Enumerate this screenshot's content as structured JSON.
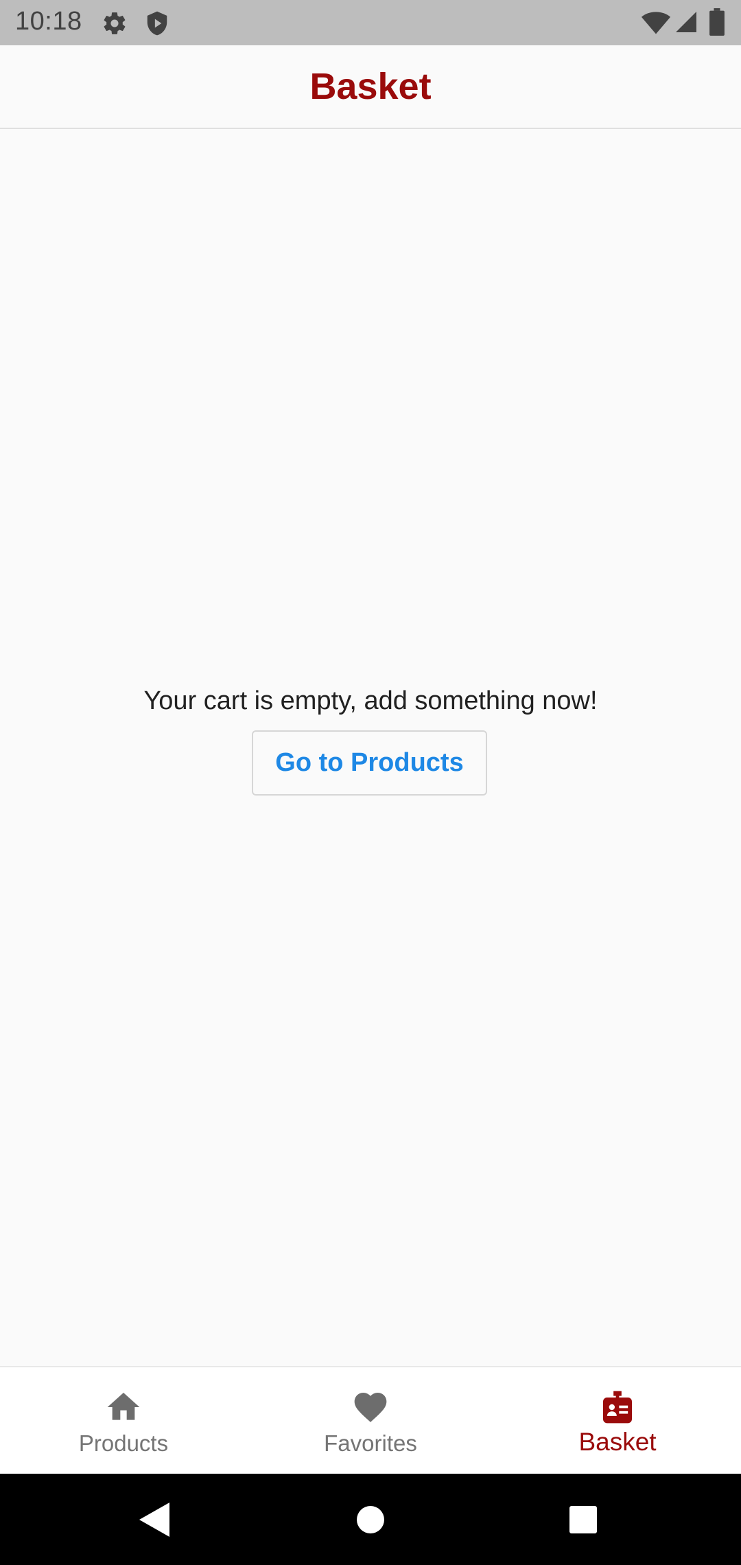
{
  "status_bar": {
    "time": "10:18",
    "icons": [
      "gear-icon",
      "shield-play-icon",
      "wifi-icon",
      "signal-icon",
      "battery-icon"
    ]
  },
  "app_bar": {
    "title": "Basket"
  },
  "main": {
    "empty_message": "Your cart is empty, add something now!",
    "go_button_label": "Go to Products"
  },
  "bottom_nav": {
    "items": [
      {
        "label": "Products",
        "icon": "home-icon",
        "active": false
      },
      {
        "label": "Favorites",
        "icon": "heart-icon",
        "active": false
      },
      {
        "label": "Basket",
        "icon": "id-badge-icon",
        "active": true
      }
    ]
  },
  "system_nav": {
    "buttons": [
      "back-icon",
      "home-circle-icon",
      "recents-square-icon"
    ]
  },
  "colors": {
    "accent": "#9a0b0b",
    "link_blue": "#1e88e5",
    "inactive_gray": "#757575",
    "status_bar_bg": "#bdbdbd"
  }
}
